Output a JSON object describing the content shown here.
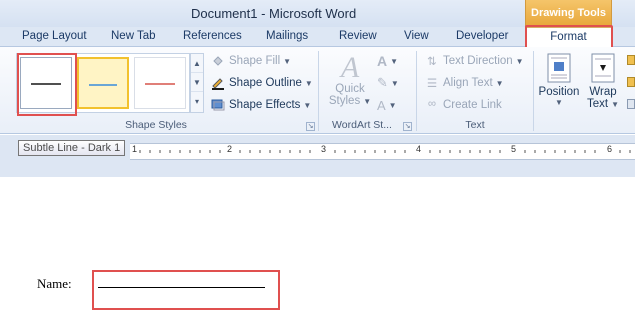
{
  "titlebar": {
    "title": "Document1  -  Microsoft Word",
    "contextual": "Drawing Tools"
  },
  "tabs": [
    "Page Layout",
    "New Tab",
    "References",
    "Mailings",
    "Review",
    "View",
    "Developer"
  ],
  "active_tab": "Format",
  "ribbon": {
    "shape_styles": {
      "label": "Shape Styles",
      "fill": "Shape Fill",
      "outline": "Shape Outline",
      "effects": "Shape Effects",
      "swatch_colors": [
        "#505050",
        "#6aa6d6",
        "#e07f78"
      ]
    },
    "wordart": {
      "label": "WordArt St...",
      "quick_styles_1": "Quick",
      "quick_styles_2": "Styles"
    },
    "text": {
      "label": "Text",
      "direction": "Text Direction",
      "align": "Align Text",
      "link": "Create Link"
    },
    "arrange": {
      "position": "Position",
      "wrap_1": "Wrap",
      "wrap_2": "Text"
    }
  },
  "tooltip": "Subtle Line - Dark 1",
  "ruler": {
    "numbers": [
      "1",
      "2",
      "3",
      "4",
      "5",
      "6"
    ]
  },
  "document": {
    "name_label": "Name:"
  },
  "colors": {
    "highlight": "#e0504f",
    "contextual": "#e7a63a"
  }
}
